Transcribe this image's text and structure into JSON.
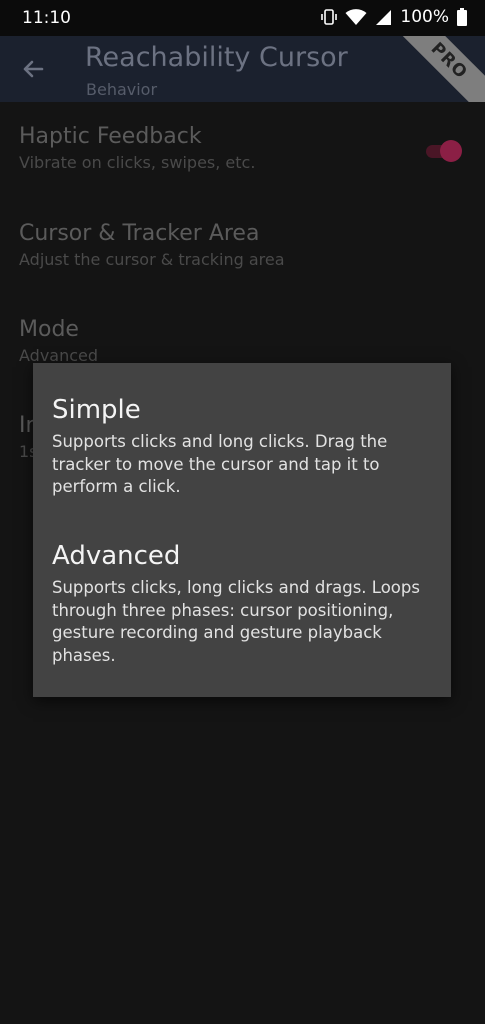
{
  "status_bar": {
    "time": "11:10",
    "battery_text": "100%",
    "icons": [
      "vibrate-icon",
      "wifi-icon",
      "cell-signal-icon",
      "battery-icon"
    ]
  },
  "app_bar": {
    "title": "Reachability Cursor",
    "subtitle": "Behavior",
    "pro_badge": "PRO"
  },
  "settings": {
    "items": [
      {
        "title": "Haptic Feedback",
        "summary": "Vibrate on clicks, swipes, etc.",
        "toggle_on": true
      },
      {
        "title": "Cursor & Tracker Area",
        "summary": "Adjust the cursor & tracking area"
      },
      {
        "title": "Mode",
        "summary": "Advanced"
      },
      {
        "title": "In",
        "summary": "1s"
      }
    ]
  },
  "dialog": {
    "options": [
      {
        "title": "Simple",
        "description": "Supports clicks and long clicks. Drag the tracker to move the cursor and tap it to perform a click."
      },
      {
        "title": "Advanced",
        "description": "Supports clicks, long clicks and drags. Loops through three phases: cursor positioning, gesture recording and gesture playback phases."
      }
    ]
  },
  "colors": {
    "accent": "#8b1f45",
    "app_bar_bg": "#1b212e",
    "dialog_bg": "#434343",
    "background": "#141414"
  }
}
